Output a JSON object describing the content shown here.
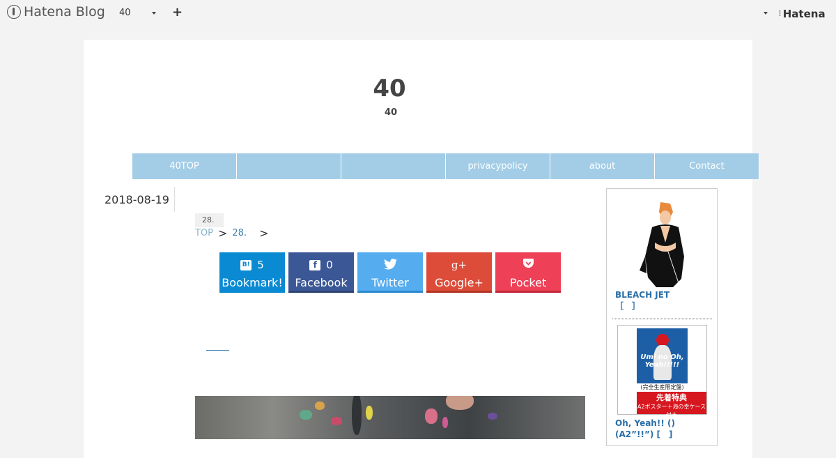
{
  "topbar": {
    "logo_text": "Hatena Blog",
    "blog_select": "40",
    "add_label": "+",
    "account_brand": "Hatena"
  },
  "site": {
    "title": "40",
    "description": "40"
  },
  "nav": {
    "items": [
      {
        "label": "40TOP"
      },
      {
        "label": ""
      },
      {
        "label": ""
      },
      {
        "label": "privacypolicy"
      },
      {
        "label": "about"
      },
      {
        "label": "Contact"
      }
    ]
  },
  "entry": {
    "date": "2018-08-19",
    "category_badge": "28.",
    "breadcrumb": {
      "top": "TOP",
      "sep": ">",
      "category": "28.",
      "sep2": ">"
    }
  },
  "share": {
    "bookmark": {
      "count": "5",
      "label": "Bookmark!",
      "icon": "hatena-bookmark-icon",
      "color": "#0a8ad3"
    },
    "facebook": {
      "count": "0",
      "label": "Facebook",
      "icon": "facebook-icon",
      "color": "#3b5796"
    },
    "twitter": {
      "label": "Twitter",
      "icon": "twitter-icon",
      "color": "#55acee"
    },
    "googleplus": {
      "label": "Google+",
      "icon": "google-plus-icon",
      "color": "#dd4c39"
    },
    "pocket": {
      "label": "Pocket",
      "icon": "pocket-icon",
      "color": "#ee4056"
    }
  },
  "sidebar": {
    "item1_title": "BLEACH JET ［　］",
    "cd_cover_text": "Umi no Oh, Yeah!!!!!",
    "cd_subtitle": "(完全生産限定盤)",
    "cd_promo_1": "先着特典",
    "cd_promo_2": "A2ポスター＋海の幸ケース付き",
    "item2_title": "Oh, Yeah!! () (A2”!!”) [　]"
  },
  "colors": {
    "page_bg": "#f3f3f3",
    "nav_bg": "#a3cde6",
    "link": "#2a6fa8"
  }
}
